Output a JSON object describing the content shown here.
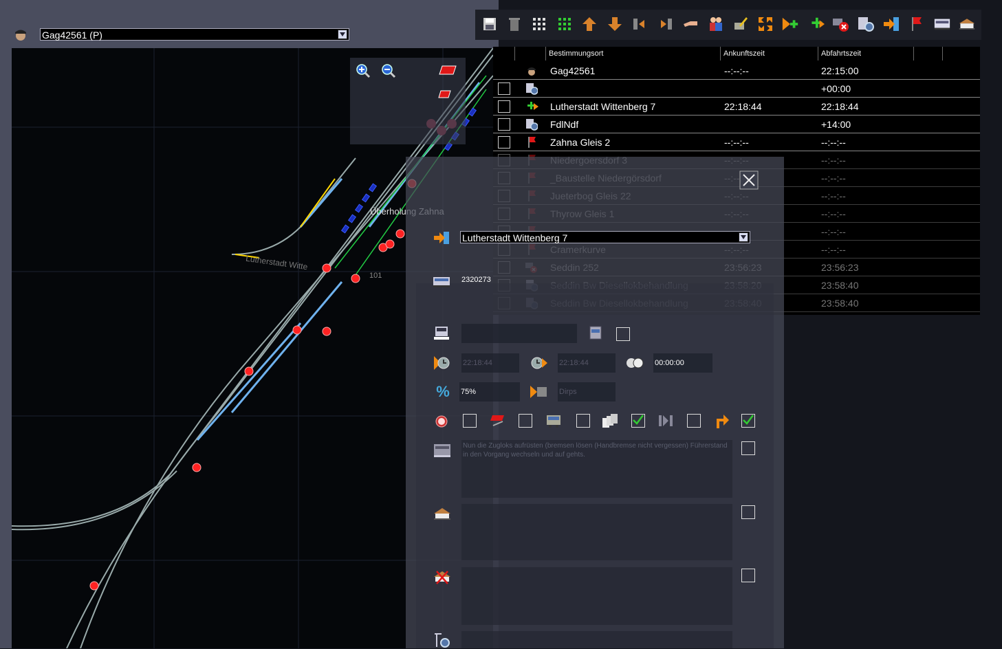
{
  "train": {
    "selected": "Gag42561 (P)"
  },
  "map": {
    "labels": {
      "overtaking": "Überholung Zahna",
      "station": "Lutherstadt Witte",
      "track_number": "101"
    }
  },
  "table": {
    "headers": {
      "destination": "Bestimmungsort",
      "arrival": "Ankunftszeit",
      "departure": "Abfahrtszeit"
    },
    "rows": [
      {
        "icon": "driver-icon",
        "checkbox": false,
        "destination": "Gag42561",
        "arrival": "--:--:--",
        "departure": "22:15:00",
        "dim": false
      },
      {
        "icon": "gear-document-icon",
        "checkbox": true,
        "destination": "",
        "arrival": "",
        "departure": "+00:00",
        "dim": false
      },
      {
        "icon": "green-plus-arrow-icon",
        "checkbox": true,
        "destination": "Lutherstadt Wittenberg 7",
        "arrival": "22:18:44",
        "departure": "22:18:44",
        "dim": false
      },
      {
        "icon": "gear-document-icon",
        "checkbox": true,
        "destination": "FdlNdf",
        "arrival": "",
        "departure": "+14:00",
        "dim": false
      },
      {
        "icon": "red-flag-icon",
        "checkbox": true,
        "destination": "Zahna Gleis 2",
        "arrival": "--:--:--",
        "departure": "--:--:--",
        "dim": false
      },
      {
        "icon": "red-flag-icon",
        "checkbox": true,
        "destination": "Niedergoersdorf 3",
        "arrival": "--:--:--",
        "departure": "--:--:--",
        "dim": true
      },
      {
        "icon": "red-flag-icon",
        "checkbox": true,
        "destination": "_Baustelle Niedergörsdorf",
        "arrival": "--:--:--",
        "departure": "--:--:--",
        "dim": true
      },
      {
        "icon": "red-flag-icon",
        "checkbox": true,
        "destination": "Jueterbog Gleis 22",
        "arrival": "--:--:--",
        "departure": "--:--:--",
        "dim": true
      },
      {
        "icon": "red-flag-icon",
        "checkbox": true,
        "destination": "Thyrow Gleis 1",
        "arrival": "--:--:--",
        "departure": "--:--:--",
        "dim": true
      },
      {
        "icon": "red-flag-icon",
        "checkbox": true,
        "destination": "",
        "arrival": "",
        "departure": "--:--:--",
        "dim": true
      },
      {
        "icon": "red-flag-icon",
        "checkbox": true,
        "destination": "Cramerkurve",
        "arrival": "--:--:--",
        "departure": "--:--:--",
        "dim": true
      },
      {
        "icon": "red-x-icon",
        "checkbox": true,
        "destination": "Seddin 252",
        "arrival": "23:56:23",
        "departure": "23:56:23",
        "dim": true
      },
      {
        "icon": "gear-document-icon",
        "checkbox": true,
        "destination": "Seddin Bw Diesellokbehandlung",
        "arrival": "23:58:20",
        "departure": "23:58:40",
        "dim": true
      },
      {
        "icon": "gear-document-icon",
        "checkbox": true,
        "destination": "Seddin Bw Diesellokbehandlung",
        "arrival": "23:58:40",
        "departure": "23:58:40",
        "dim": true
      }
    ]
  },
  "edit": {
    "station_select": "Lutherstadt Wittenberg 7",
    "train_number": "2320273",
    "arrival_time": "22:18:44",
    "departure_time": "22:18:44",
    "wait_time": "00:00:00",
    "percent": "75%",
    "speed_placeholder": "Dirps",
    "note": "Nun die Zugloks aufrüsten (bremsen lösen (Handbremse nicht vergessen) Führerstand in den Vorgang wechseln und auf gehts."
  }
}
